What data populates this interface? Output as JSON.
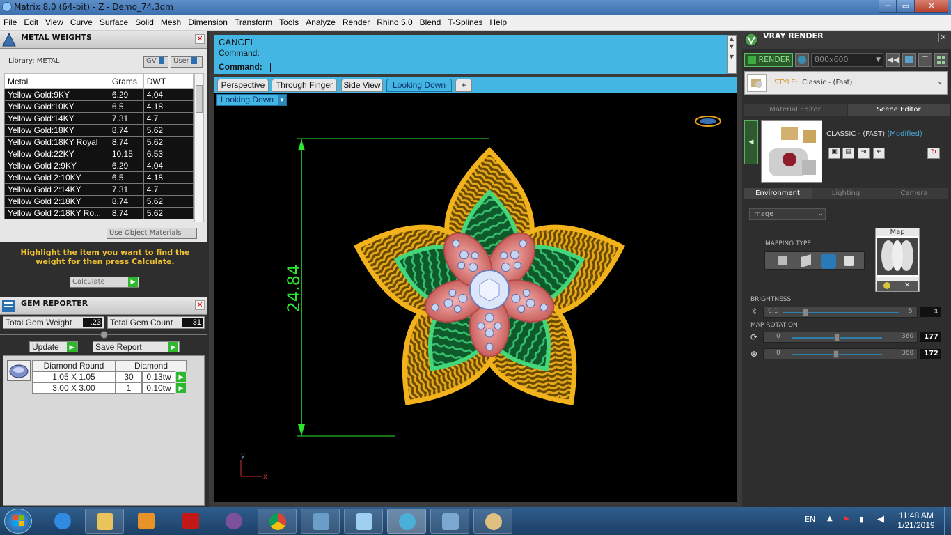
{
  "window": {
    "title": "Matrix 8.0 (64-bit) - Z - Demo_74.3dm",
    "min": "─",
    "max": "▭",
    "close": "✕"
  },
  "menu": [
    "File",
    "Edit",
    "View",
    "Curve",
    "Surface",
    "Solid",
    "Mesh",
    "Dimension",
    "Transform",
    "Tools",
    "Analyze",
    "Render",
    "Rhino 5.0",
    "Blend",
    "T-Splines",
    "Help"
  ],
  "metal_weights": {
    "title": "METAL WEIGHTS",
    "library_label": "Library: METAL",
    "gv_label": "GV",
    "user_label": "User",
    "columns": [
      "Metal",
      "Grams",
      "DWT"
    ],
    "rows": [
      [
        "Yellow Gold:9KY",
        "6.29",
        "4.04"
      ],
      [
        "Yellow Gold:10KY",
        "6.5",
        "4.18"
      ],
      [
        "Yellow Gold:14KY",
        "7.31",
        "4.7"
      ],
      [
        "Yellow Gold:18KY",
        "8.74",
        "5.62"
      ],
      [
        "Yellow Gold:18KY Royal",
        "8.74",
        "5.62"
      ],
      [
        "Yellow Gold:22KY",
        "10.15",
        "6.53"
      ],
      [
        "Yellow Gold 2:9KY",
        "6.29",
        "4.04"
      ],
      [
        "Yellow Gold 2:10KY",
        "6.5",
        "4.18"
      ],
      [
        "Yellow Gold 2:14KY",
        "7.31",
        "4.7"
      ],
      [
        "Yellow Gold 2:18KY",
        "8.74",
        "5.62"
      ],
      [
        "Yellow Gold 2:18KY Ro...",
        "8.74",
        "5.62"
      ]
    ],
    "use_object_materials": "Use Object Materials",
    "hint": "Highlight the item you want to find the weight for then press Calculate.",
    "calculate": "Calculate"
  },
  "gem_reporter": {
    "title": "GEM REPORTER",
    "total_weight_label": "Total Gem Weight",
    "total_weight": ".23",
    "total_count_label": "Total Gem Count",
    "total_count": "31",
    "update": "Update",
    "save_report": "Save Report",
    "columns": [
      "Diamond Round",
      "Diamond"
    ],
    "rows": [
      [
        "1.05 X 1.05",
        "30",
        "0.13tw"
      ],
      [
        "3.00 X 3.00",
        "1",
        "0.10tw"
      ]
    ]
  },
  "command": {
    "line1": "CANCEL",
    "line2": "Command:",
    "prompt": "Command:"
  },
  "view_tabs": [
    "Perspective",
    "Through Finger",
    "Side View",
    "Looking Down"
  ],
  "add_tab": "+",
  "viewport": {
    "name": "Looking Down",
    "dimension": "24.84",
    "axis_y": "y",
    "axis_x": "x"
  },
  "vray": {
    "title": "VRAY RENDER",
    "render": "RENDER",
    "resolution": "800x600",
    "style_label": "STYLE:",
    "style_value": "Classic - (Fast)",
    "tabs": [
      "Material Editor",
      "Scene Editor"
    ],
    "scene_name": "CLASSIC - (FAST)",
    "modified": "(Modified)",
    "env_tabs": [
      "Environment",
      "Lighting",
      "Camera"
    ],
    "env_type": "Image",
    "mapping_type": "MAPPING TYPE",
    "map_label": "Map",
    "brightness_label": "BRIGHTNESS",
    "brightness_min": "0.1",
    "brightness_max": "5",
    "brightness_val": "1",
    "rotation_label": "MAP ROTATION",
    "rot1_min": "0",
    "rot1_max": "360",
    "rot1_val": "177",
    "rot2_min": "0",
    "rot2_max": "360",
    "rot2_val": "172"
  },
  "taskbar": {
    "lang": "EN",
    "time": "11:48 AM",
    "date": "1/21/2019"
  }
}
